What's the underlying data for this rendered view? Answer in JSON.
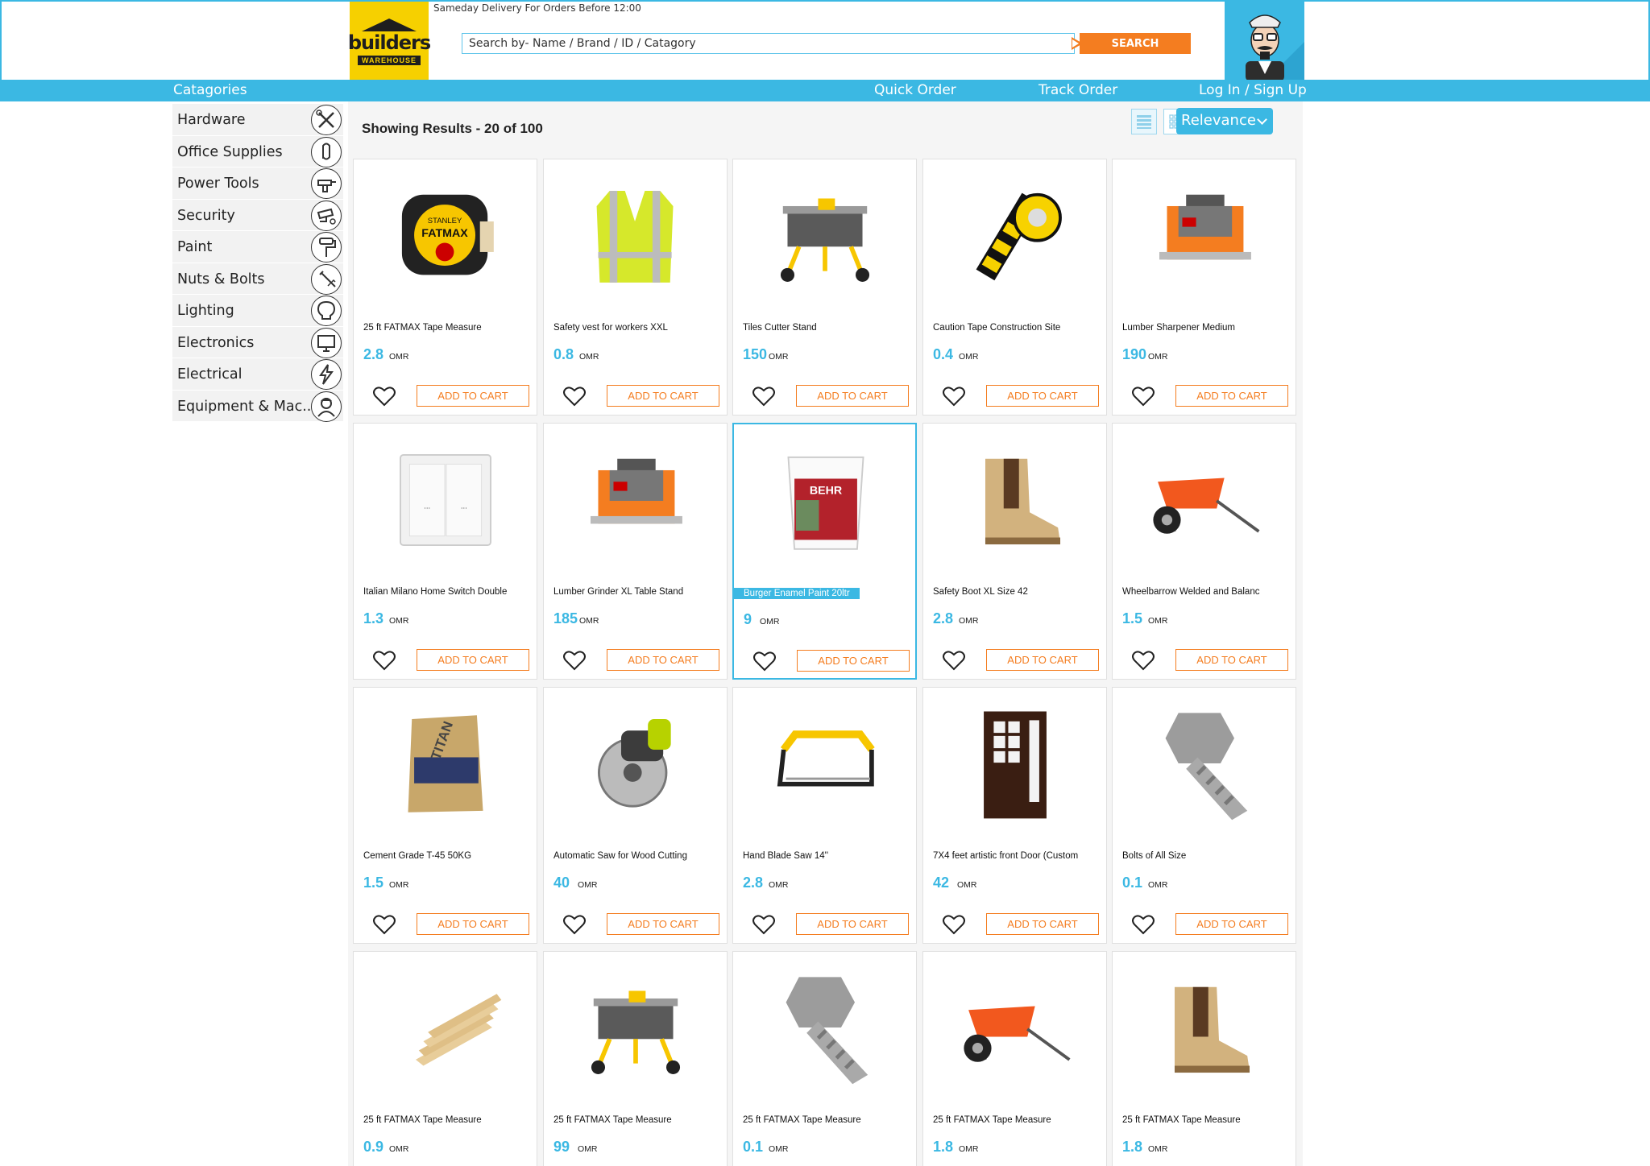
{
  "header": {
    "delivery_notice": "Sameday Delivery For Orders Before 12:00",
    "logo_text": "builders",
    "logo_sub": "WAREHOUSE",
    "search_placeholder": "Search by- Name / Brand / ID / Catagory",
    "search_button": "SEARCH"
  },
  "nav": {
    "categories": "Catagories",
    "quick_order": "Quick Order",
    "track_order": "Track Order",
    "login": "Log In / Sign Up"
  },
  "sidebar": {
    "items": [
      {
        "label": "Hardware",
        "icon": "tools-icon"
      },
      {
        "label": "Office Supplies",
        "icon": "paperclip-icon"
      },
      {
        "label": "Power Tools",
        "icon": "drill-icon"
      },
      {
        "label": "Security",
        "icon": "cctv-camera-icon"
      },
      {
        "label": "Paint",
        "icon": "paint-roller-icon"
      },
      {
        "label": "Nuts & Bolts",
        "icon": "bolt-icon"
      },
      {
        "label": "Lighting",
        "icon": "lightbulb-icon"
      },
      {
        "label": "Electronics",
        "icon": "monitor-icon"
      },
      {
        "label": "Electrical",
        "icon": "lightning-plug-icon"
      },
      {
        "label": "Equipment & Mac..",
        "icon": "worker-icon"
      }
    ]
  },
  "results": {
    "title": "Showing Results - 20 of 100",
    "sort_label": "Relevance",
    "add_to_cart": "ADD TO CART"
  },
  "colors": {
    "accent": "#3bb8e3",
    "orange": "#f47d20",
    "logo_yellow": "#f6d000"
  },
  "products": [
    {
      "name": "25 ft FATMAX Tape Measure",
      "price": "2.8",
      "currency": "OMR",
      "image": "tape-measure"
    },
    {
      "name": "Safety vest for workers XXL",
      "price": "0.8",
      "currency": "OMR",
      "image": "safety-vest"
    },
    {
      "name": "Tiles Cutter Stand",
      "price": "150",
      "currency": "OMR",
      "image": "table-saw"
    },
    {
      "name": "Caution Tape Construction Site",
      "price": "0.4",
      "currency": "OMR",
      "image": "caution-tape"
    },
    {
      "name": "Lumber Sharpener Medium",
      "price": "190",
      "currency": "OMR",
      "image": "planer"
    },
    {
      "name": "Italian Milano Home Switch Double",
      "price": "1.3",
      "currency": "OMR",
      "image": "switch"
    },
    {
      "name": "Lumber Grinder XL Table Stand",
      "price": "185",
      "currency": "OMR",
      "image": "planer"
    },
    {
      "name": "Burger Enamel Paint 20ltr",
      "price": "9",
      "currency": "OMR",
      "image": "paint-bucket"
    },
    {
      "name": "Safety Boot XL Size 42",
      "price": "2.8",
      "currency": "OMR",
      "image": "boot"
    },
    {
      "name": "Wheelbarrow Welded and Balanc",
      "price": "1.5",
      "currency": "OMR",
      "image": "wheelbarrow"
    },
    {
      "name": "Cement Grade T-45 50KG",
      "price": "1.5",
      "currency": "OMR",
      "image": "cement-bag"
    },
    {
      "name": "Automatic Saw for Wood Cutting",
      "price": "40",
      "currency": "OMR",
      "image": "circular-saw"
    },
    {
      "name": "Hand Blade Saw 14''",
      "price": "2.8",
      "currency": "OMR",
      "image": "hacksaw"
    },
    {
      "name": "7X4 feet artistic front Door (Custom",
      "price": "42",
      "currency": "OMR",
      "image": "door"
    },
    {
      "name": "Bolts of All Size",
      "price": "0.1",
      "currency": "OMR",
      "image": "bolt"
    },
    {
      "name": "25 ft FATMAX Tape Measure",
      "price": "0.9",
      "currency": "OMR",
      "image": "lumber"
    },
    {
      "name": "25 ft FATMAX Tape Measure",
      "price": "99",
      "currency": "OMR",
      "image": "table-saw"
    },
    {
      "name": "25 ft FATMAX Tape Measure",
      "price": "0.1",
      "currency": "OMR",
      "image": "bolt"
    },
    {
      "name": "25 ft FATMAX Tape Measure",
      "price": "1.8",
      "currency": "OMR",
      "image": "wheelbarrow"
    },
    {
      "name": "25 ft FATMAX Tape Measure",
      "price": "1.8",
      "currency": "OMR",
      "image": "boot"
    }
  ]
}
